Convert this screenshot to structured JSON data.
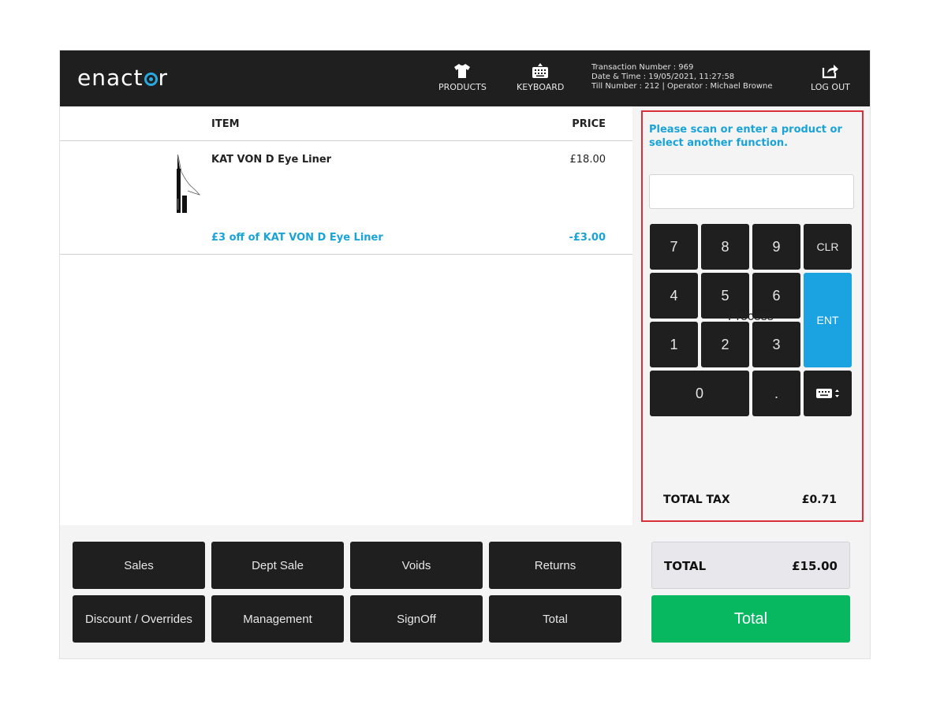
{
  "header": {
    "logo": "enact",
    "logo_tail": "r",
    "products_label": "PRODUCTS",
    "keyboard_label": "KEYBOARD",
    "logout_label": "LOG OUT",
    "transaction_line": "Transaction Number : 969",
    "datetime_line": "Date & Time : 19/05/2021, 11:27:58",
    "till_line": "Till Number : 212  |  Operator : Michael Browne",
    "icons": {
      "products": "tshirt-icon",
      "keyboard": "keyboard-icon",
      "logout": "logout-icon"
    }
  },
  "list": {
    "col_item": "ITEM",
    "col_price": "PRICE",
    "items": [
      {
        "name": "KAT VON D Eye Liner",
        "price": "£18.00",
        "discount_name": "£3 off of KAT VON D Eye Liner",
        "discount_price": "-£3.00"
      }
    ]
  },
  "panel": {
    "prompt": "Please scan or enter a product or select another function.",
    "keypad": {
      "k7": "7",
      "k8": "8",
      "k9": "9",
      "clr": "CLR",
      "k4": "4",
      "k5": "5",
      "k6": "6",
      "ent": "ENT",
      "k1": "1",
      "k2": "2",
      "k3": "3",
      "k0": "0",
      "dot": "."
    },
    "process_label": "Process",
    "tax_label": "TOTAL TAX",
    "tax_value": "£0.71"
  },
  "functions": {
    "sales": "Sales",
    "dept_sale": "Dept Sale",
    "voids": "Voids",
    "returns": "Returns",
    "discount": "Discount / Overrides",
    "management": "Management",
    "signoff": "SignOff",
    "total": "Total"
  },
  "summary": {
    "total_label": "TOTAL",
    "total_value": "£15.00",
    "total_button": "Total"
  },
  "colors": {
    "accent": "#1aa3d8",
    "header_bg": "#1f1f1f",
    "total_green": "#08b860",
    "alert_border": "#d9303a"
  }
}
